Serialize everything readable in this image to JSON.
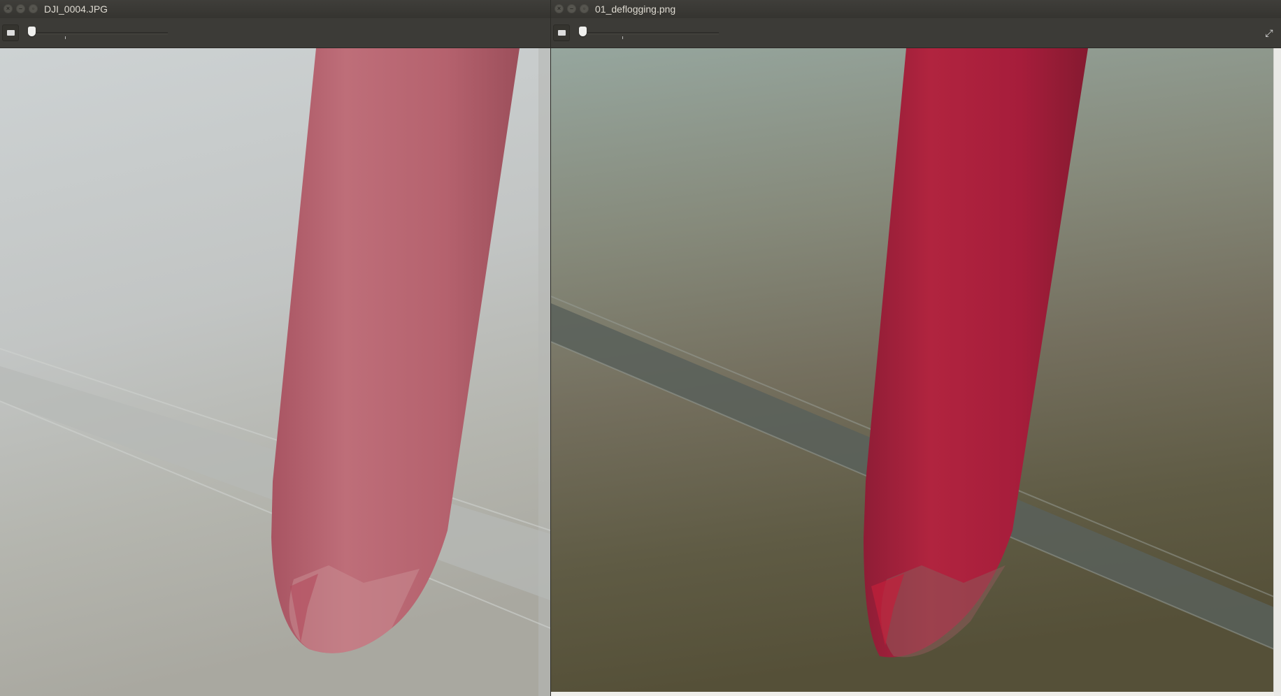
{
  "left_window": {
    "title": "DJI_0004.JPG",
    "image_alt": "foggy aerial photo of red wind turbine blade"
  },
  "right_window": {
    "title": "01_deflogging.png",
    "image_alt": "defogged aerial photo of red wind turbine blade"
  },
  "icons": {
    "close": "close-icon",
    "minimize": "minimize-icon",
    "maximize": "maximize-icon",
    "zoom_out": "zoom-out-icon",
    "fullscreen": "fullscreen-icon"
  },
  "colors": {
    "titlebar": "#3c3b37",
    "foggy_sky": "#c3c7c7",
    "foggy_ground": "#a9a9a2",
    "foggy_blade": "#b3656f",
    "clear_sky": "#87978e",
    "clear_ground": "#5b5940",
    "clear_blade": "#a7203f"
  }
}
